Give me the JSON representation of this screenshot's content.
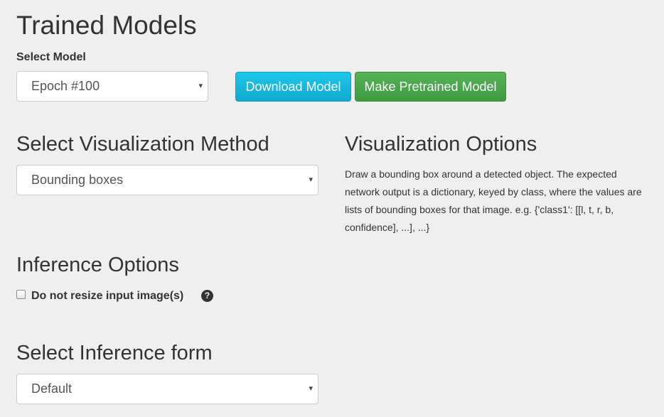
{
  "page": {
    "title": "Trained Models"
  },
  "model": {
    "label": "Select Model",
    "selected": "Epoch #100"
  },
  "buttons": {
    "download": "Download Model",
    "pretrained": "Make Pretrained Model"
  },
  "visualization": {
    "method_heading": "Select Visualization Method",
    "method_selected": "Bounding boxes",
    "options_heading": "Visualization Options",
    "description": "Draw a bounding box around a detected object. The expected network output is a dictionary, keyed by class, where the values are lists of bounding boxes for that image. e.g. {'class1': [[l, t, r, b, confidence], ...], ...}"
  },
  "inference": {
    "heading": "Inference Options",
    "resize_label": "Do not resize input image(s)",
    "resize_checked": false,
    "help_glyph": "?"
  },
  "inference_form": {
    "heading": "Select Inference form",
    "selected": "Default"
  },
  "icons": {
    "select_caret": "caret-down-icon",
    "help": "question-circle-icon"
  },
  "colors": {
    "background": "#efefef",
    "download_button": "#13b5dd",
    "pretrained_button": "#47a749",
    "text": "#333333"
  }
}
